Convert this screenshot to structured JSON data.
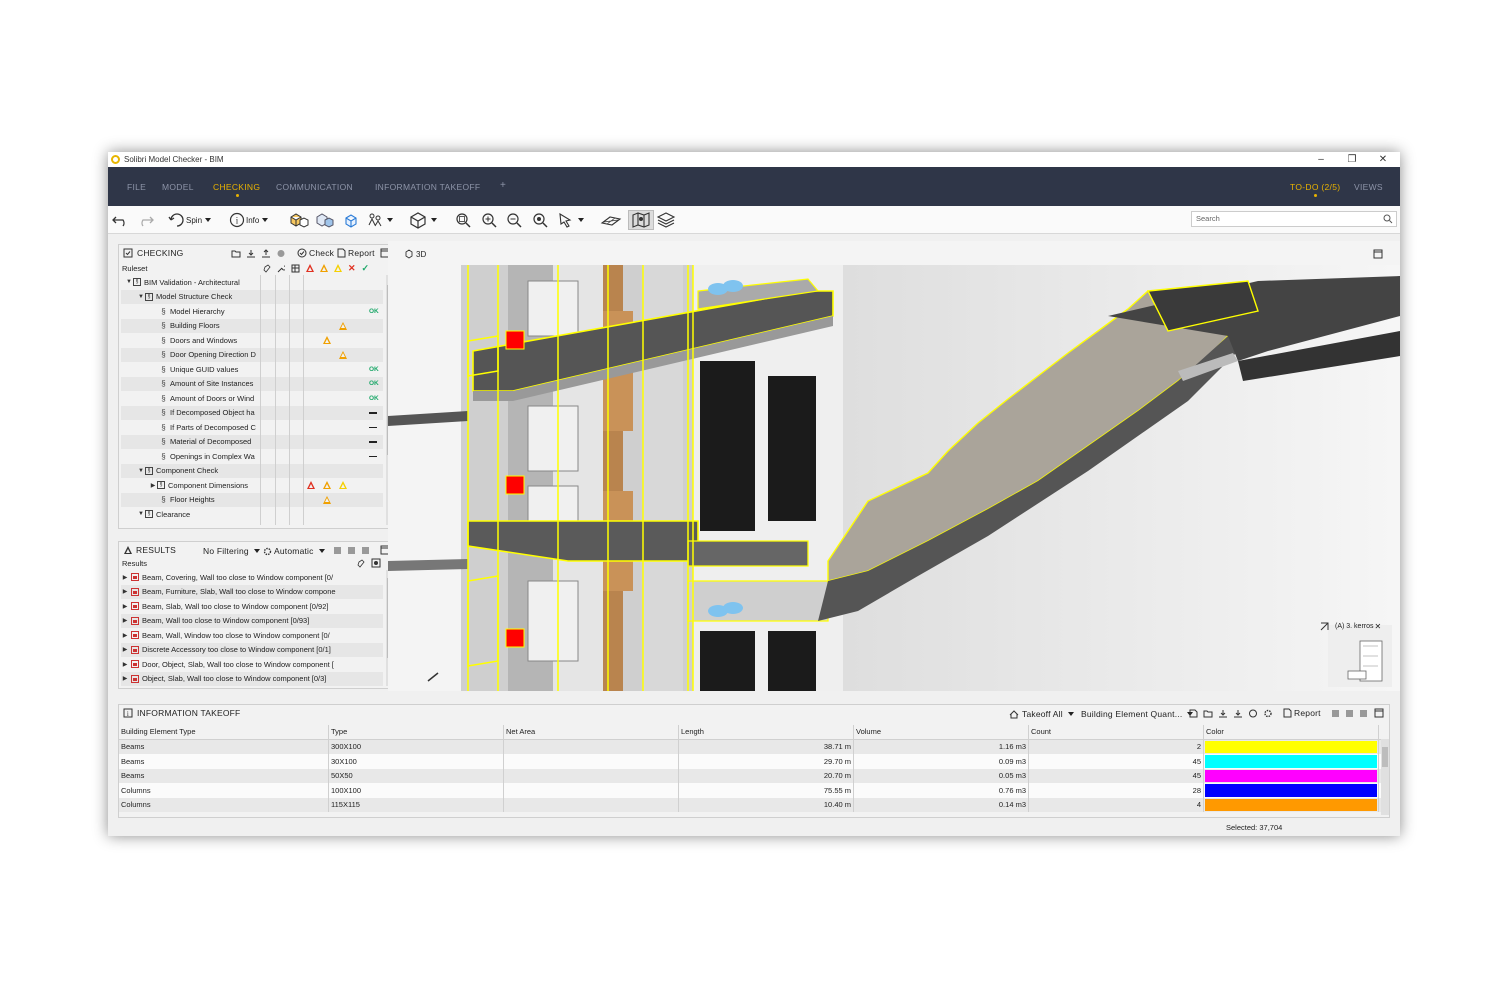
{
  "window": {
    "title": "Solibri Model Checker - BIM"
  },
  "menu": {
    "items": [
      "FILE",
      "MODEL",
      "CHECKING",
      "COMMUNICATION",
      "INFORMATION TAKEOFF",
      "+"
    ],
    "active": "CHECKING",
    "todo": "TO-DO (2/5)",
    "views": "VIEWS"
  },
  "toolbar": {
    "spin": "Spin",
    "info": "Info",
    "search_placeholder": "Search"
  },
  "checking": {
    "title": "CHECKING",
    "check": "Check",
    "report": "Report",
    "ruleset_header": "Ruleset",
    "rows": [
      {
        "label": "BIM Validation - Architectural",
        "status": ""
      },
      {
        "label": "Model Structure Check",
        "status": ""
      },
      {
        "label": "Model Hierarchy",
        "status": "ok"
      },
      {
        "label": "Building Floors",
        "status": "warn"
      },
      {
        "label": "Doors and Windows",
        "status": "warn-mid"
      },
      {
        "label": "Door Opening Direction D",
        "status": "warn"
      },
      {
        "label": "Unique GUID values",
        "status": "ok"
      },
      {
        "label": "Amount of Site Instances",
        "status": "ok"
      },
      {
        "label": "Amount of Doors or Wind",
        "status": "ok"
      },
      {
        "label": "If Decomposed Object ha",
        "status": "dash"
      },
      {
        "label": "If Parts of Decomposed C",
        "status": "dash"
      },
      {
        "label": "Material of Decomposed",
        "status": "dash"
      },
      {
        "label": "Openings in Complex Wa",
        "status": "dash"
      },
      {
        "label": "Component Check",
        "status": ""
      },
      {
        "label": "Component Dimensions",
        "status": "triple"
      },
      {
        "label": "Floor Heights",
        "status": "warn-mid"
      },
      {
        "label": "Clearance",
        "status": ""
      }
    ],
    "ok_label": "OK"
  },
  "results": {
    "title": "RESULTS",
    "filter": "No Filtering",
    "mode": "Automatic",
    "header": "Results",
    "rows": [
      "Beam, Covering, Wall too close to Window component [0/",
      "Beam, Furniture, Slab, Wall too close to Window compone",
      "Beam, Slab, Wall too close to Window component [0/92]",
      "Beam, Wall too close to Window component [0/93]",
      "Beam, Wall, Window too close to Window component [0/",
      "Discrete Accessory too close to Window component [0/1]",
      "Door, Object, Slab, Wall too close to Window component [",
      "Object, Slab, Wall too close to Window component [0/3]"
    ]
  },
  "viewer": {
    "label": "3D",
    "floor_label": "(A) 3. kerros"
  },
  "takeoff": {
    "title": "INFORMATION TAKEOFF",
    "takeoff_all": "Takeoff All",
    "preset": "Building Element Quant...",
    "report": "Report",
    "columns": [
      "Building Element Type",
      "Type",
      "Net Area",
      "Length",
      "Volume",
      "Count",
      "Color"
    ],
    "rows": [
      {
        "type": "Beams",
        "sub": "300X100",
        "area": "",
        "length": "38.71 m",
        "volume": "1.16 m3",
        "count": "2",
        "color": "#ffff00"
      },
      {
        "type": "Beams",
        "sub": "30X100",
        "area": "",
        "length": "29.70 m",
        "volume": "0.09 m3",
        "count": "45",
        "color": "#00ffff"
      },
      {
        "type": "Beams",
        "sub": "50X50",
        "area": "",
        "length": "20.70 m",
        "volume": "0.05 m3",
        "count": "45",
        "color": "#ff00ff"
      },
      {
        "type": "Columns",
        "sub": "100X100",
        "area": "",
        "length": "75.55 m",
        "volume": "0.76 m3",
        "count": "28",
        "color": "#0000ff"
      },
      {
        "type": "Columns",
        "sub": "115X115",
        "area": "",
        "length": "10.40 m",
        "volume": "0.14 m3",
        "count": "4",
        "color": "#ff9900"
      }
    ]
  },
  "status": {
    "selected": "Selected: 37,704"
  },
  "colors": {
    "menubar": "#2f3648",
    "accent": "#e8b200",
    "highlight": "#ffff00"
  }
}
